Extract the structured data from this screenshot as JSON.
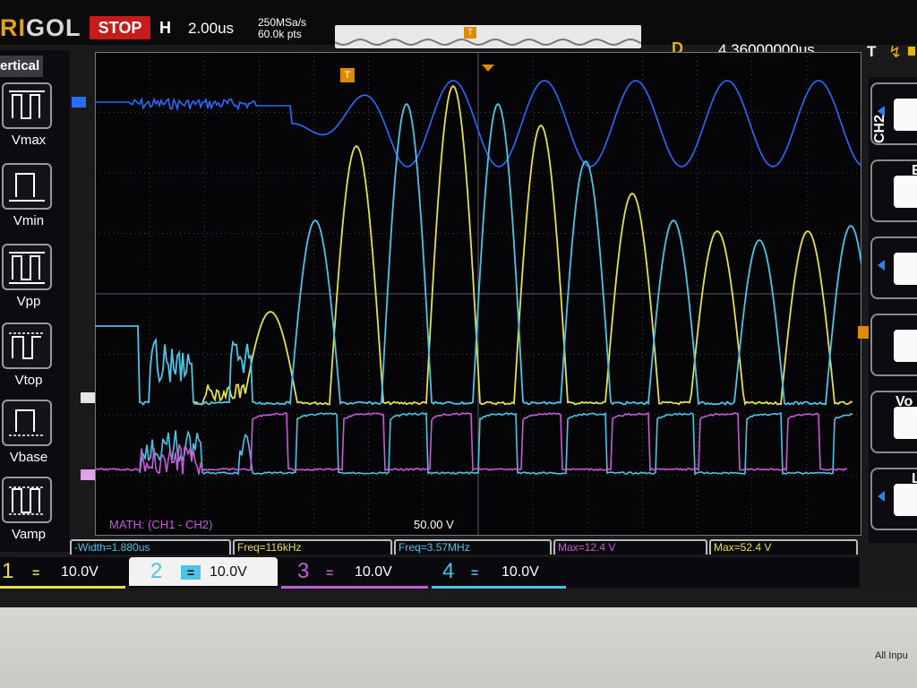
{
  "topbar": {
    "brand_prefix": "RI",
    "brand_rest": "GOL",
    "run_state": "STOP",
    "h_label": "H",
    "timebase": "2.00us",
    "sample_rate": "250MSa/s",
    "memory_depth": "60.0k pts",
    "trigger_marker": "T",
    "delay_label": "D",
    "delay_value": "4.36000000us",
    "trigger_label": "T"
  },
  "left_menu": {
    "title": "ertical",
    "items": [
      {
        "label": "Vmax"
      },
      {
        "label": "Vmin"
      },
      {
        "label": "Vpp"
      },
      {
        "label": "Vtop"
      },
      {
        "label": "Vbase"
      },
      {
        "label": "Vamp"
      }
    ]
  },
  "right_menu": {
    "channel_label": "CH2",
    "heads": [
      "",
      "E",
      "",
      "",
      "Vo",
      "L"
    ]
  },
  "math": {
    "label": "MATH:  (CH1 - CH2)",
    "scale": "50.00 V"
  },
  "measurements": [
    {
      "text": "-Width=1.880us",
      "color": "#4cc4e6"
    },
    {
      "text": "Freq=116kHz",
      "color": "#e6e04c"
    },
    {
      "text": "Freq=3.57MHz",
      "color": "#4cc4e6"
    },
    {
      "text": "Max=12.4 V",
      "color": "#c65bd6"
    },
    {
      "text": "Max=52.4 V",
      "color": "#e6e04c"
    }
  ],
  "channels": [
    {
      "num": "1",
      "value": "10.0V",
      "color": "#e6e04c"
    },
    {
      "num": "2",
      "value": "10.0V",
      "color": "#4cc4e6"
    },
    {
      "num": "3",
      "value": "10.0V",
      "color": "#c65bd6"
    },
    {
      "num": "4",
      "value": "10.0V",
      "color": "#4cc4e6"
    }
  ],
  "colors": {
    "ch1": "#e6e04c",
    "ch2": "#4cc4e6",
    "ch3": "#c65bd6",
    "ch4": "#2a6bff",
    "grid": "#5a5a62"
  },
  "bottom_label": "All Inpu"
}
